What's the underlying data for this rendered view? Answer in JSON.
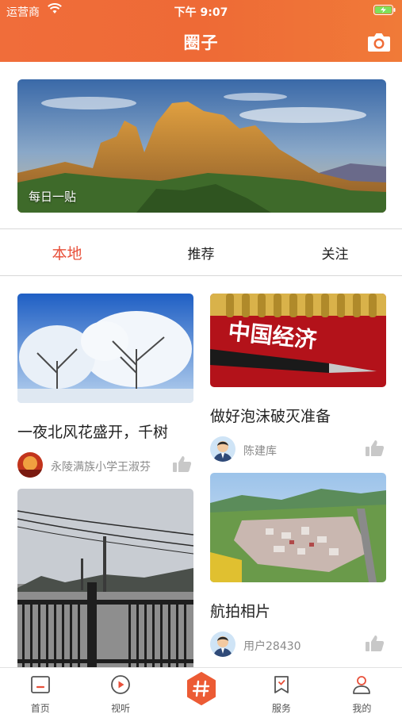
{
  "status_bar": {
    "carrier": "运营商",
    "time": "下午 9:07"
  },
  "header": {
    "title": "圈子",
    "camera_icon": "camera-icon"
  },
  "banner": {
    "caption": "每日一贴"
  },
  "tabs": [
    {
      "label": "本地",
      "active": true
    },
    {
      "label": "推荐",
      "active": false
    },
    {
      "label": "关注",
      "active": false
    }
  ],
  "feed": {
    "left": [
      {
        "title": "一夜北风花盛开，千树",
        "author": "永陵满族小学王淑芬"
      },
      {
        "title": "",
        "author": ""
      }
    ],
    "right": [
      {
        "title": "做好泡沫破灭准备",
        "author": "陈建库",
        "image_text": "中国经济"
      },
      {
        "title": "航拍相片",
        "author": "用户28430"
      }
    ]
  },
  "tabbar": [
    {
      "label": "首页",
      "icon": "home-icon"
    },
    {
      "label": "视听",
      "icon": "play-icon"
    },
    {
      "label": "",
      "icon": "hashtag-icon"
    },
    {
      "label": "服务",
      "icon": "bookmark-icon"
    },
    {
      "label": "我的",
      "icon": "user-icon"
    }
  ],
  "colors": {
    "header": "#ef6c37",
    "active_tab": "#e8503a",
    "center_button": "#ec5b34"
  }
}
